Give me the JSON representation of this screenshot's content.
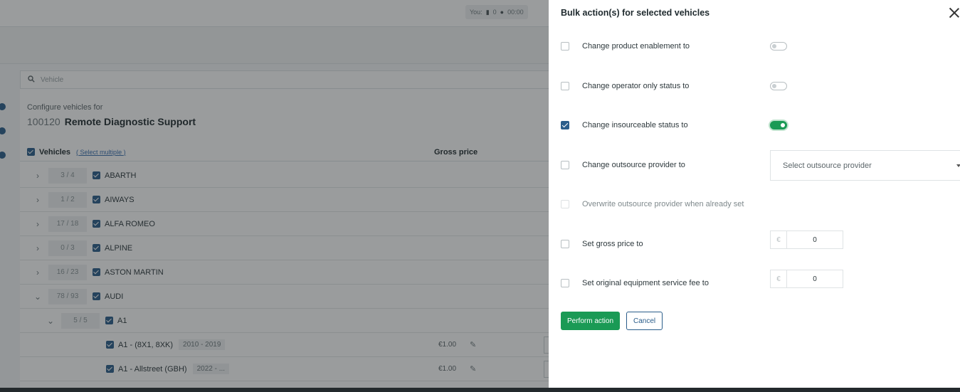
{
  "status_bar": {
    "label": "You:",
    "count": "0",
    "time": "00:00"
  },
  "search": {
    "placeholder": "Vehicle"
  },
  "config": {
    "subtitle": "Configure vehicles for",
    "code": "100120",
    "name": "Remote Diagnostic Support"
  },
  "table": {
    "header_vehicles": "Vehicles",
    "select_multiple": "( Select multiple )",
    "header_gross_price": "Gross price",
    "rows": [
      {
        "count": "3 / 4",
        "label": "ABARTH"
      },
      {
        "count": "1 / 2",
        "label": "AIWAYS"
      },
      {
        "count": "17 / 18",
        "label": "ALFA ROMEO"
      },
      {
        "count": "0 / 3",
        "label": "ALPINE"
      },
      {
        "count": "16 / 23",
        "label": "ASTON MARTIN"
      },
      {
        "count": "78 / 93",
        "label": "AUDI"
      },
      {
        "count": "5 / 5",
        "label": "A1"
      },
      {
        "label": "A1 - (8X1, 8XK)",
        "years": "2010 - 2019",
        "price": "€1.00"
      },
      {
        "label": "A1 - Allstreet (GBH)",
        "years": "2022 - ...",
        "price": "€1.00"
      }
    ]
  },
  "panel": {
    "title": "Bulk action(s) for selected vehicles",
    "options": {
      "product_enablement": {
        "label": "Change product enablement to",
        "checked": false,
        "toggle_on": false
      },
      "operator_only": {
        "label": "Change operator only status to",
        "checked": false,
        "toggle_on": false
      },
      "insourceable": {
        "label": "Change insourceable status to",
        "checked": true,
        "toggle_on": true
      },
      "outsource_provider": {
        "label": "Change outsource provider to",
        "checked": false,
        "select_placeholder": "Select outsource provider"
      },
      "overwrite_provider": {
        "label": "Overwrite outsource provider when already set",
        "checked": false,
        "disabled": true
      },
      "gross_price": {
        "label": "Set gross price to",
        "checked": false,
        "currency": "€",
        "value": "0"
      },
      "oe_service_fee": {
        "label": "Set original equipment service fee to",
        "checked": false,
        "currency": "€",
        "value": "0"
      }
    },
    "perform_label": "Perform action",
    "cancel_label": "Cancel"
  },
  "colors": {
    "accent_green": "#1a9a55",
    "checkbox_blue": "#2a5d8a"
  },
  "icons": [
    "close-icon",
    "search-icon",
    "chevron-right-icon",
    "chevron-down-icon",
    "edit-icon",
    "caret-down-icon",
    "battery-icon",
    "clock-icon"
  ]
}
